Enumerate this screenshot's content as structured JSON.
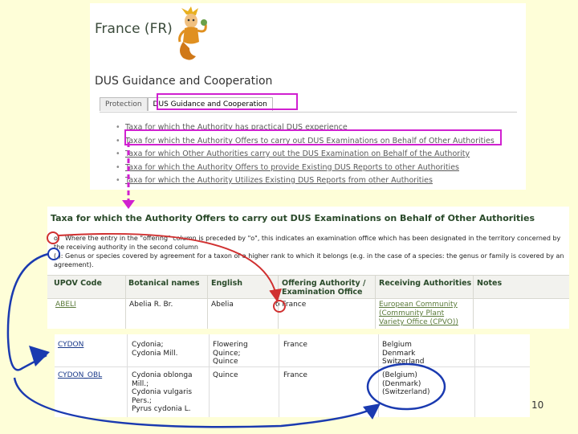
{
  "top_panel": {
    "country_title": "France (FR)",
    "section_title": "DUS Guidance and Cooperation",
    "tabs": [
      "Protection",
      "DUS Guidance and Cooperation"
    ],
    "links": [
      "Taxa for which the Authority has practical DUS experience",
      "Taxa for which the Authority Offers to carry out DUS Examinations on Behalf of Other Authorities",
      "Taxa for which Other Authorities carry out the DUS Examination on Behalf of the Authority",
      "Taxa for which the Authority Offers to provide Existing DUS Reports to other Authorities",
      "Taxa for which the Authority Utilizes Existing DUS Reports from other Authorities"
    ]
  },
  "mid_panel": {
    "title": "Taxa for which the Authority Offers to carry out DUS Examinations on Behalf of Other Authorities",
    "note_o_marker": "o:",
    "note_o": "Where the entry in the \"offering\" column is preceded by \"o\", this indicates an examination office which has been designated in the territory concerned by the receiving authority in the second column",
    "note_paren_marker": "( ):",
    "note_paren": "Genus or species covered by agreement for a taxon of a higher rank to which it belongs (e.g. in the case of a species: the genus or family is covered by an agreement).",
    "headers": [
      "UPOV Code",
      "Botanical names",
      "English",
      "Offering Authority / Examination Office",
      "Receiving Authorities",
      "Notes"
    ],
    "row": {
      "code": "ABELI",
      "botanical": "Abelia R. Br.",
      "english": "Abelia",
      "offering": "o France",
      "receiving": "European Community (Community Plant Variety Office (CPVO))",
      "notes": ""
    }
  },
  "bottom_panel": {
    "rows": [
      {
        "code": "CYDON",
        "botanical": [
          "Cydonia;",
          "Cydonia Mill."
        ],
        "english": [
          "Flowering",
          "Quince;",
          "Quince"
        ],
        "offering": "France",
        "receiving": [
          "Belgium",
          "Denmark",
          "Switzerland"
        ]
      },
      {
        "code": "CYDON_OBL",
        "botanical": [
          "Cydonia oblonga",
          "Mill.;",
          "Cydonia vulgaris",
          "Pers.;",
          "Pyrus cydonia L."
        ],
        "english": [
          "Quince"
        ],
        "offering": "France",
        "receiving": [
          "(Belgium)",
          "(Denmark)",
          "(Switzerland)"
        ]
      }
    ]
  },
  "page_number": "10",
  "colors": {
    "background": "#fefed8",
    "highlight_magenta": "#d020d0",
    "annotation_blue": "#1a3ab0",
    "annotation_red": "#d03030"
  },
  "icons": [
    "mascot-illustration"
  ]
}
